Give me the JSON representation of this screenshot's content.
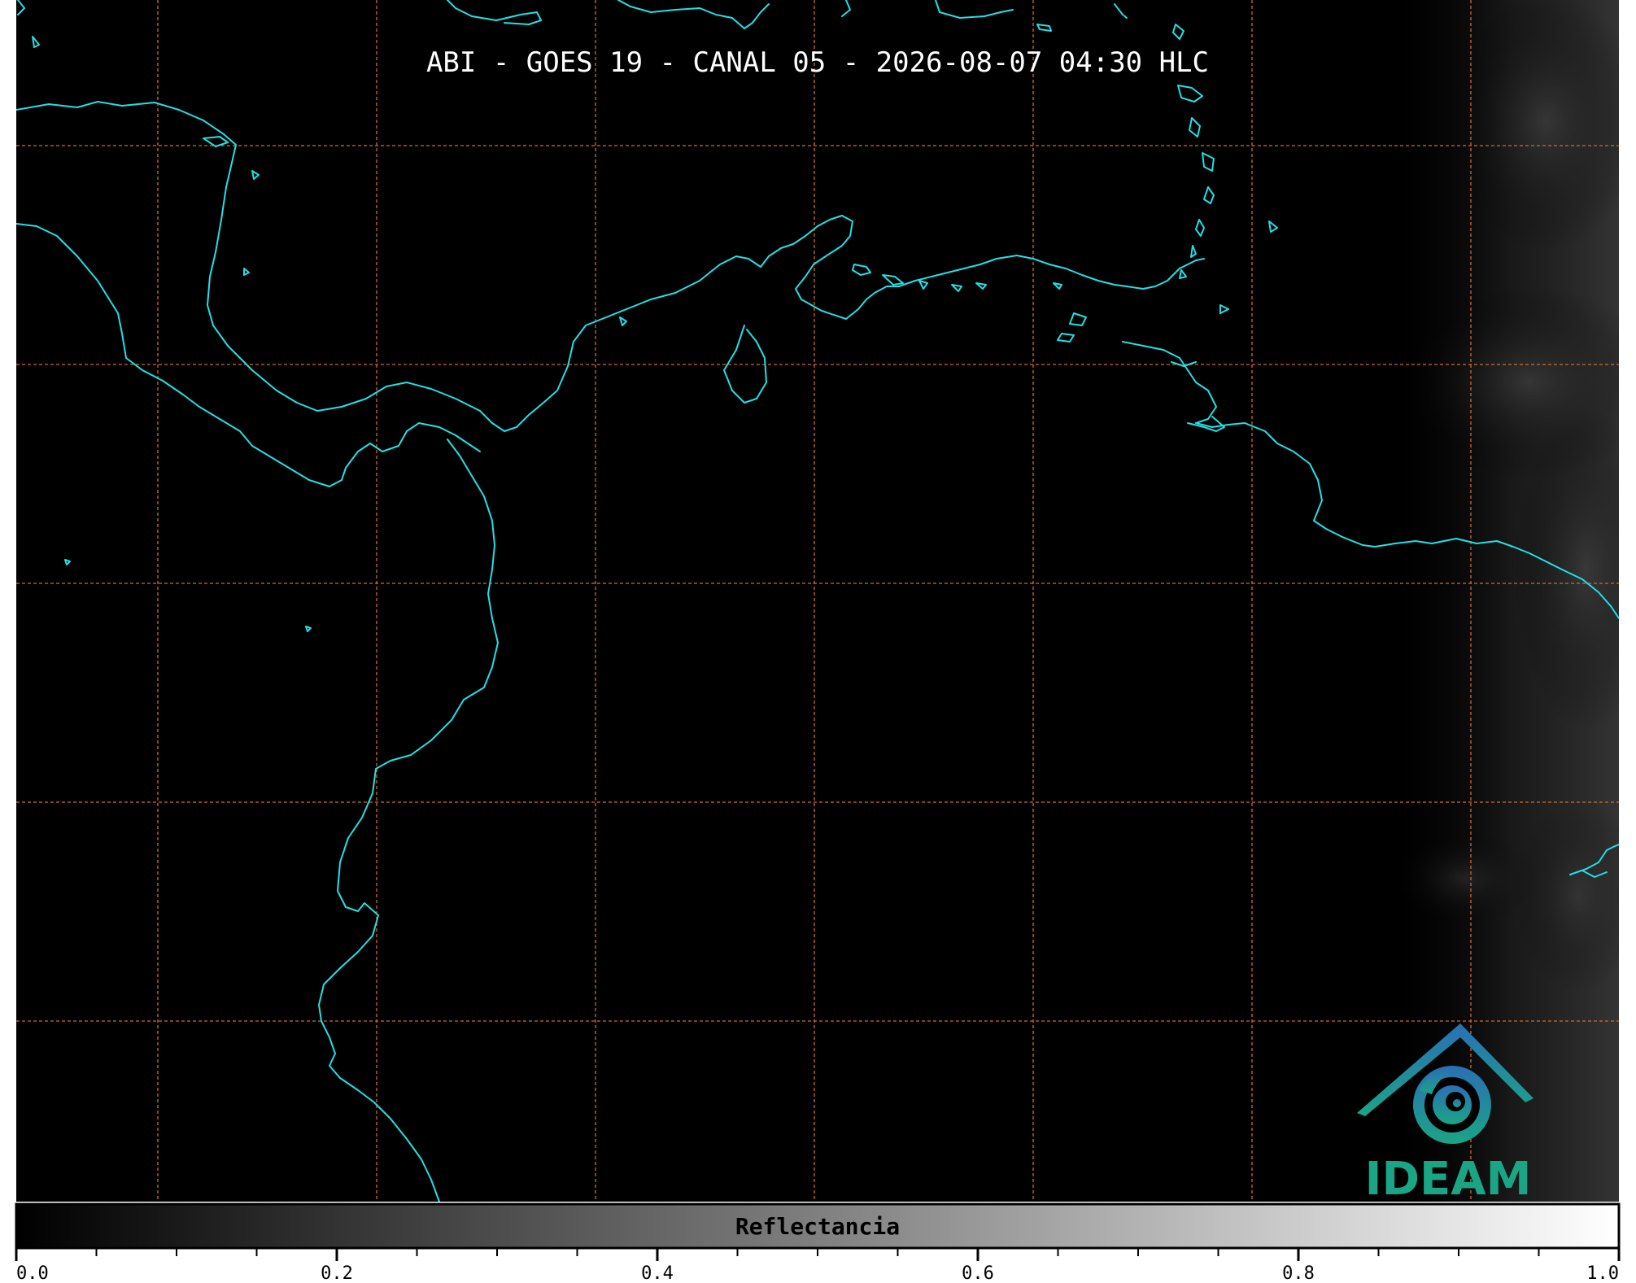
{
  "title": "ABI - GOES 19 - CANAL 05 - 2026-08-07 04:30 HLC",
  "colorbar": {
    "label": "Reflectancia",
    "range": [
      0.0,
      1.0
    ],
    "major_ticks": [
      "0.0",
      "0.2",
      "0.4",
      "0.6",
      "0.8",
      "1.0"
    ],
    "minor_step": 0.05,
    "colormap": "grayscale (black to white)"
  },
  "logo": {
    "text": "IDEAM",
    "icon": "ideam-mountain-swirl-logo"
  },
  "map": {
    "background_color": "#000000",
    "coastline_color": "#22e0e6",
    "graticule_color": "#d06a2e",
    "graticule_style": "dashed"
  }
}
